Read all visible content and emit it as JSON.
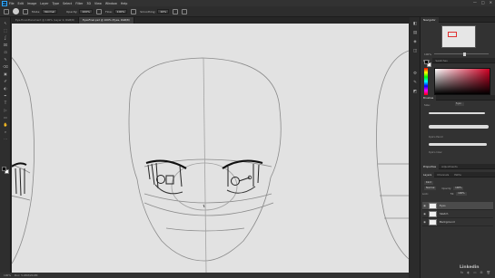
{
  "app": {
    "logo": "Ps",
    "menu": [
      "File",
      "Edit",
      "Image",
      "Layer",
      "Type",
      "Select",
      "Filter",
      "3D",
      "View",
      "Window",
      "Help"
    ],
    "window_controls": [
      "—",
      "□",
      "✕"
    ]
  },
  "options_bar": {
    "mode_label": "Mode:",
    "mode_value": "Normal",
    "opacity_label": "Opacity:",
    "opacity_value": "100%",
    "flow_label": "Flow:",
    "flow_value": "100%",
    "smoothing_label": "Smoothing:",
    "smoothing_value": "10%"
  },
  "tabs": [
    {
      "label": "Eye-Final-Placement @ 100% (Layer 0, RGB/8)",
      "active": false
    },
    {
      "label": "EyesFinal.psd @ 100% (Eyes, RGB/8)",
      "active": true
    }
  ],
  "tools": [
    "↖",
    "⬚",
    "ʆ",
    "⌧",
    "⊡",
    "✎",
    "⌫",
    "▣",
    "✐",
    "◐",
    "✒",
    "T",
    "▷",
    "▭",
    "✋",
    "⌕",
    "⋯"
  ],
  "status": {
    "zoom": "100%",
    "doc": "Doc: 5.93M/20.6M"
  },
  "side_icons": [
    "◧",
    "▤",
    "◈",
    "◫",
    "⚙",
    "✎",
    "◩"
  ],
  "panels": {
    "navigator_tab": "Navigator",
    "color_tabs": [
      "Color",
      "Swatches"
    ],
    "brush_tab": "Brushes",
    "brush_size_label": "Size:",
    "brush_size_value": "5 px",
    "brush_names": [
      "Kyle's Pencil",
      "Kyle's Inker"
    ],
    "zoom_value": "100%",
    "properties_tabs": [
      "Properties",
      "Adjustments"
    ],
    "layers_tabs": [
      "Layers",
      "Channels",
      "Paths"
    ],
    "kind_label": "Kind",
    "blend_mode": "Normal",
    "opacity_label": "Opacity:",
    "opacity_value": "100%",
    "lock_label": "Lock:",
    "fill_label": "Fill:",
    "fill_value": "100%",
    "layers": [
      {
        "name": "Eyes",
        "selected": true
      },
      {
        "name": "Sketch",
        "selected": false
      },
      {
        "name": "Background",
        "selected": false
      }
    ],
    "footer_icons": [
      "fx",
      "◐",
      "▭",
      "⊞",
      "🗑"
    ]
  },
  "watermark": "Linkedin"
}
